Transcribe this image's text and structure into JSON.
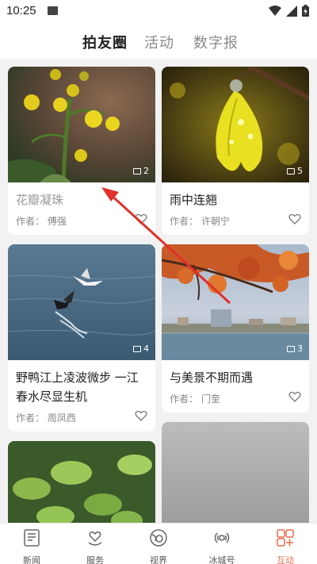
{
  "status": {
    "time": "10:25"
  },
  "header": {
    "tabs": [
      {
        "label": "拍友圈",
        "active": true
      },
      {
        "label": "活动",
        "active": false
      },
      {
        "label": "数字报",
        "active": false
      }
    ]
  },
  "feed": {
    "cards": [
      {
        "title": "花瓣凝珠",
        "author": "作者：  傅强",
        "photo_count": "2",
        "title_muted": true,
        "image": "yellow-flower-buds-with-raindrops"
      },
      {
        "title": "雨中连翘",
        "author": "作者：  许朝宁",
        "photo_count": "5",
        "image": "forsythia-flower-with-raindrops"
      },
      {
        "title": "野鸭江上凌波微步 一江春水尽显生机",
        "author": "作者：  周凤西",
        "photo_count": "4",
        "image": "ducks-and-gull-over-river"
      },
      {
        "title": "与美景不期而遇",
        "author": "作者：  门奎",
        "photo_count": "3",
        "image": "autumn-tree-over-lake-cityscape"
      },
      {
        "title": "",
        "author": "",
        "photo_count": "",
        "image": "green-leaves"
      },
      {
        "title": "",
        "author": "",
        "photo_count": "",
        "image": "grey-water-surface"
      }
    ]
  },
  "bottom_nav": {
    "items": [
      {
        "label": "新闻",
        "icon": "newspaper-icon"
      },
      {
        "label": "服务",
        "icon": "heart-hand-icon"
      },
      {
        "label": "视界",
        "icon": "globe-lens-icon"
      },
      {
        "label": "冰城号",
        "icon": "broadcast-icon"
      },
      {
        "label": "互动",
        "icon": "interaction-icon",
        "active": true
      }
    ]
  },
  "colors": {
    "accent": "#e86a4a",
    "annotation_arrow": "#e0302a"
  }
}
